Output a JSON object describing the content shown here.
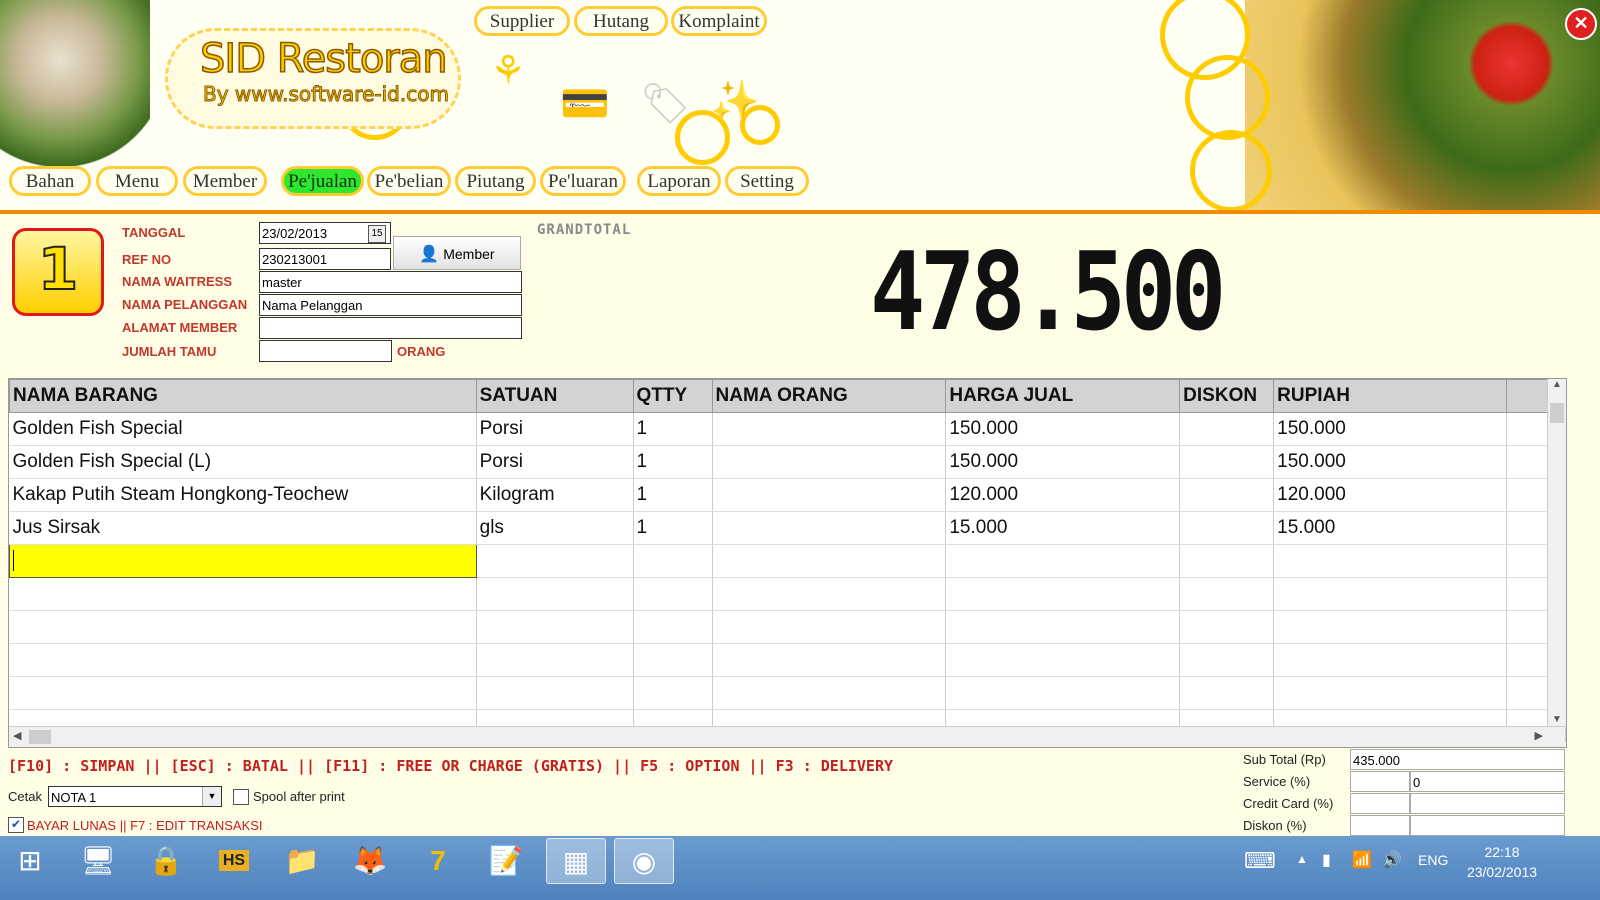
{
  "logo": {
    "title": "SID Restoran",
    "subtitle": "By www.software-id.com"
  },
  "top_nav": [
    "Supplier",
    "Hutang",
    "Komplaint"
  ],
  "main_nav": [
    "Bahan",
    "Menu",
    "Member",
    "Pe'jualan",
    "Pe'belian",
    "Piutang",
    "Pe'luaran",
    "Laporan",
    "Setting"
  ],
  "active_nav": "Pe'jualan",
  "table_number": "1",
  "form": {
    "tanggal_label": "TANGGAL",
    "tanggal": "23/02/2013",
    "refno_label": "REF NO",
    "refno": "230213001",
    "waitress_label": "NAMA WAITRESS",
    "waitress": "master",
    "pelanggan_label": "NAMA PELANGGAN",
    "pelanggan": "Nama Pelanggan",
    "alamat_label": "ALAMAT MEMBER",
    "alamat": "",
    "tamu_label": "JUMLAH TAMU",
    "tamu": "",
    "tamu_unit": "ORANG",
    "member_button": "Member"
  },
  "grandtotal": {
    "label": "GRANDTOTAL",
    "value": "478.500"
  },
  "grid": {
    "columns": [
      "NAMA BARANG",
      "SATUAN",
      "QTTY",
      "NAMA ORANG",
      "HARGA JUAL",
      "DISKON",
      "RUPIAH"
    ],
    "rows": [
      [
        "Golden Fish Special",
        "Porsi",
        "1",
        "",
        "150.000",
        "",
        "150.000"
      ],
      [
        "Golden Fish Special (L)",
        "Porsi",
        "1",
        "",
        "150.000",
        "",
        "150.000"
      ],
      [
        "Kakap Putih Steam Hongkong-Teochew",
        "Kilogram",
        "1",
        "",
        "120.000",
        "",
        "120.000"
      ],
      [
        "Jus Sirsak",
        "gls",
        "1",
        "",
        "15.000",
        "",
        "15.000"
      ]
    ]
  },
  "shortcuts": "[F10] : SIMPAN  ||  [ESC] : BATAL || [F11]  : FREE OR CHARGE (GRATIS) || F5 : OPTION || F3 : DELIVERY",
  "print": {
    "label": "Cetak",
    "value": "NOTA 1",
    "spool_label": "Spool after print",
    "spool_checked": false
  },
  "bayar": {
    "label": "BAYAR LUNAS || F7 : EDIT TRANSAKSI",
    "checked": true
  },
  "summary": {
    "subtotal_label": "Sub Total (Rp)",
    "subtotal": "435.000",
    "service_label": "Service (%)",
    "service": "0",
    "cc_label": "Credit Card (%)",
    "cc": "",
    "diskon_label": "Diskon (%)",
    "diskon": ""
  },
  "taskbar": {
    "apps": [
      "start-icon",
      "computer-icon",
      "lock-icon",
      "hs-icon",
      "folder-icon",
      "firefox-icon",
      "seven-icon",
      "notepad-icon",
      "pos-icon",
      "media-icon"
    ],
    "lang": "ENG",
    "time": "22:18",
    "date": "23/02/2013"
  }
}
